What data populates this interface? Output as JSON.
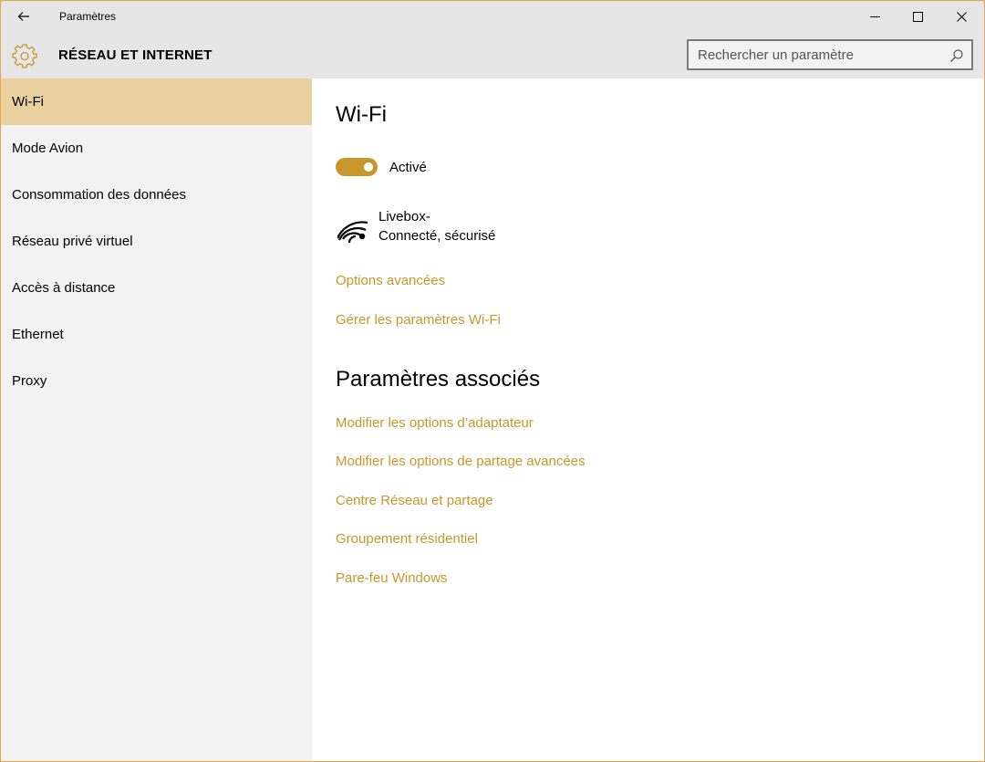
{
  "window": {
    "title": "Paramètres",
    "accent_color": "#c9962a",
    "selected_bg": "#e9d09f"
  },
  "header": {
    "section_title": "RÉSEAU ET INTERNET",
    "search_placeholder": "Rechercher un paramètre"
  },
  "sidebar": {
    "items": [
      {
        "label": "Wi-Fi",
        "selected": true
      },
      {
        "label": "Mode Avion"
      },
      {
        "label": "Consommation des données"
      },
      {
        "label": "Réseau privé virtuel"
      },
      {
        "label": "Accès à distance"
      },
      {
        "label": "Ethernet"
      },
      {
        "label": "Proxy"
      }
    ]
  },
  "main": {
    "title": "Wi-Fi",
    "toggle_label": "Activé",
    "toggle_on": true,
    "network": {
      "name": "Livebox-",
      "status": "Connecté, sécurisé"
    },
    "links": {
      "advanced": "Options avancées",
      "manage": "Gérer les paramètres Wi-Fi"
    },
    "related_title": "Paramètres associés",
    "related_links": [
      "Modifier les options d’adaptateur",
      "Modifier les options de partage avancées",
      "Centre Réseau et partage",
      "Groupement résidentiel",
      "Pare-feu Windows"
    ]
  },
  "icons": {
    "back": "back-arrow-icon",
    "gear": "gear-icon",
    "search": "search-icon",
    "wifi": "wifi-signal-icon",
    "minimize": "minimize-icon",
    "maximize": "maximize-icon",
    "close": "close-icon"
  }
}
